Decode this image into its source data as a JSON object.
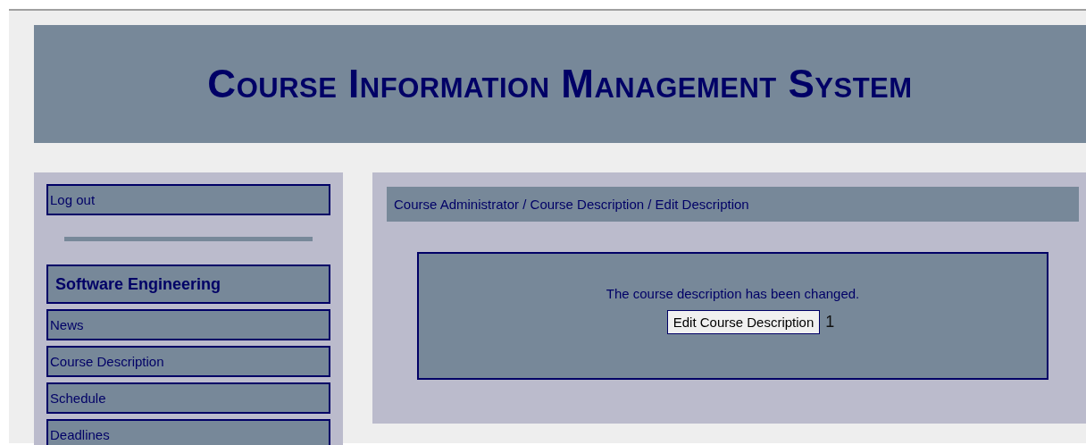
{
  "header": {
    "title": "Course Information Management System"
  },
  "sidebar": {
    "logout": "Log out",
    "course": {
      "title": "Software Engineering",
      "links": [
        "News",
        "Course Description",
        "Schedule",
        "Deadlines"
      ]
    }
  },
  "main": {
    "breadcrumb": "Course Administrator / Course Description / Edit Description",
    "message": "The course description has been changed.",
    "button": "Edit Course Description",
    "button_note": "1"
  }
}
